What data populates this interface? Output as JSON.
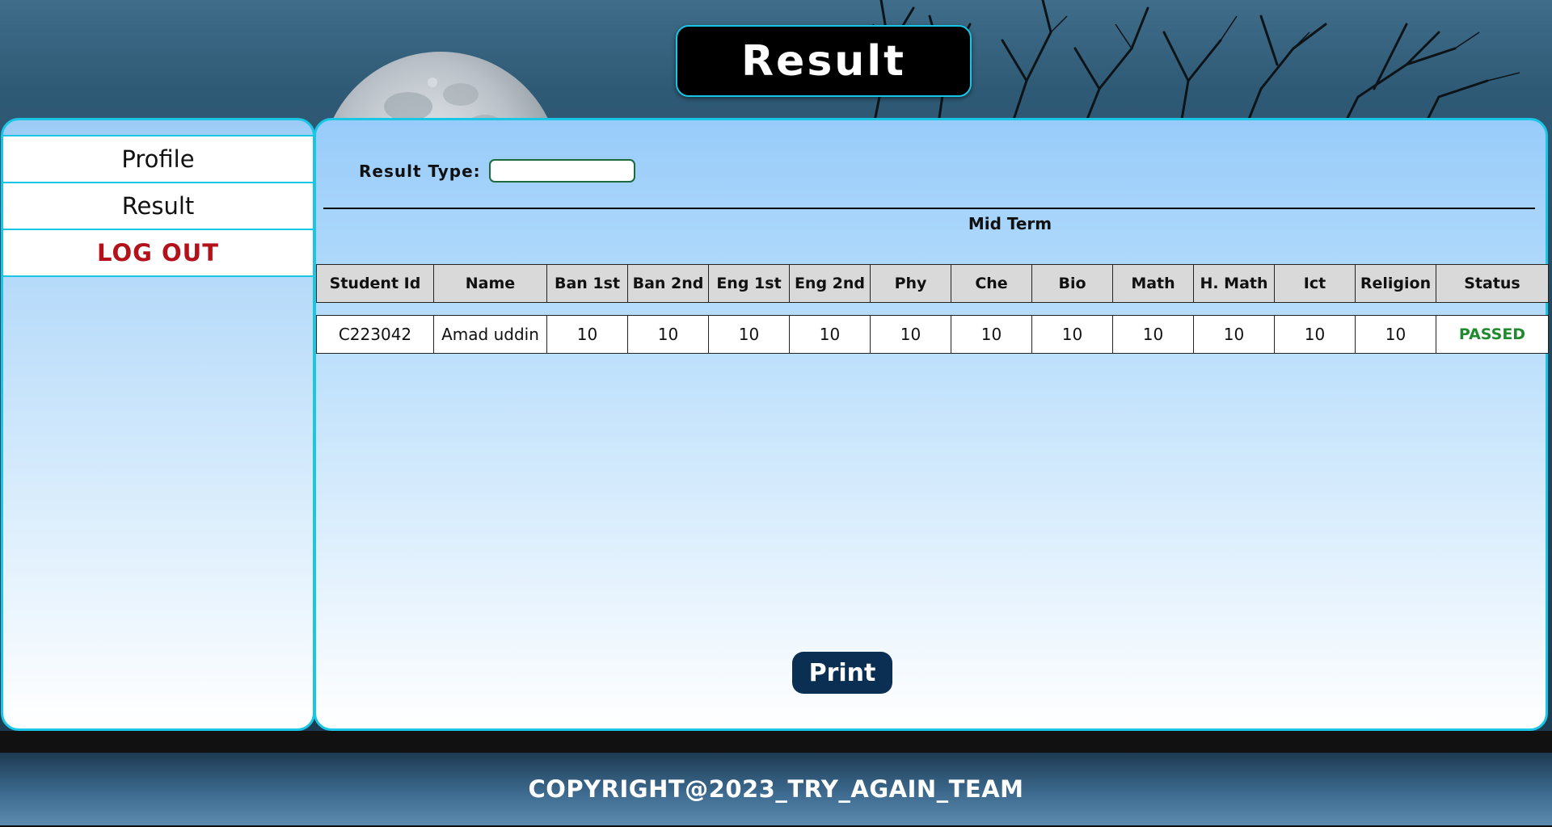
{
  "header": {
    "title": "Result"
  },
  "sidebar": {
    "items": [
      {
        "label": "Profile"
      },
      {
        "label": "Result"
      },
      {
        "label": "LOG OUT"
      }
    ]
  },
  "main": {
    "result_type_label": "Result Type:",
    "result_type_value": "",
    "section_title": "Mid Term",
    "table": {
      "columns": [
        "Student Id",
        "Name",
        "Ban 1st",
        "Ban 2nd",
        "Eng 1st",
        "Eng 2nd",
        "Phy",
        "Che",
        "Bio",
        "Math",
        "H. Math",
        "Ict",
        "Religion",
        "Status"
      ],
      "rows": [
        [
          "C223042",
          "Amad uddin",
          "10",
          "10",
          "10",
          "10",
          "10",
          "10",
          "10",
          "10",
          "10",
          "10",
          "10",
          "PASSED"
        ]
      ]
    },
    "print_label": "Print"
  },
  "footer": {
    "copyright": "COPYRIGHT@2023_TRY_AGAIN_TEAM"
  },
  "colors": {
    "accent_border": "#19c6e6",
    "logout_red": "#b3121a",
    "status_pass_green": "#1f8a2e",
    "print_button": "#0b2f52"
  }
}
